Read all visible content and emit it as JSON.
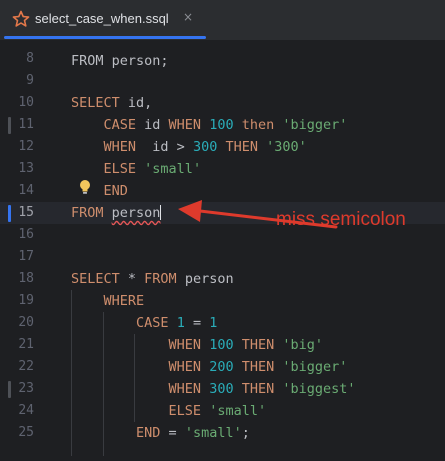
{
  "tab": {
    "filename": "select_case_when.ssql",
    "close_glyph": "×",
    "icon": "star-file-icon",
    "accent_color": "#3574f0"
  },
  "editor": {
    "partial_top_line": "FROM person;",
    "lines": [
      {
        "num": "8",
        "tokens": []
      },
      {
        "num": "9",
        "tokens": []
      },
      {
        "num": "10",
        "tokens": [
          {
            "t": "kw",
            "v": "SELECT"
          },
          {
            "t": "id",
            "v": " id,"
          }
        ]
      },
      {
        "num": "11",
        "tokens": [
          {
            "t": "id",
            "v": "    "
          },
          {
            "t": "kw",
            "v": "CASE"
          },
          {
            "t": "id",
            "v": " id "
          },
          {
            "t": "kw",
            "v": "WHEN"
          },
          {
            "t": "id",
            "v": " "
          },
          {
            "t": "num",
            "v": "100"
          },
          {
            "t": "id",
            "v": " "
          },
          {
            "t": "kw",
            "v": "then"
          },
          {
            "t": "id",
            "v": " "
          },
          {
            "t": "str",
            "v": "'bigger'"
          }
        ]
      },
      {
        "num": "12",
        "tokens": [
          {
            "t": "id",
            "v": "    "
          },
          {
            "t": "kw",
            "v": "WHEN"
          },
          {
            "t": "id",
            "v": "  id > "
          },
          {
            "t": "num",
            "v": "300"
          },
          {
            "t": "id",
            "v": " "
          },
          {
            "t": "kw",
            "v": "THEN"
          },
          {
            "t": "id",
            "v": " "
          },
          {
            "t": "str",
            "v": "'300'"
          }
        ]
      },
      {
        "num": "13",
        "tokens": [
          {
            "t": "id",
            "v": "    "
          },
          {
            "t": "kw",
            "v": "ELSE"
          },
          {
            "t": "id",
            "v": " "
          },
          {
            "t": "str",
            "v": "'small'"
          }
        ]
      },
      {
        "num": "14",
        "tokens": [
          {
            "t": "id",
            "v": "    "
          },
          {
            "t": "kw",
            "v": "END"
          }
        ]
      },
      {
        "num": "15",
        "tokens": [
          {
            "t": "kw",
            "v": "FROM"
          },
          {
            "t": "id",
            "v": " "
          },
          {
            "t": "err",
            "v": "person"
          }
        ]
      },
      {
        "num": "16",
        "tokens": []
      },
      {
        "num": "17",
        "tokens": []
      },
      {
        "num": "18",
        "tokens": [
          {
            "t": "kw",
            "v": "SELECT"
          },
          {
            "t": "id",
            "v": " * "
          },
          {
            "t": "kw",
            "v": "FROM"
          },
          {
            "t": "id",
            "v": " person"
          }
        ]
      },
      {
        "num": "19",
        "tokens": [
          {
            "t": "id",
            "v": "    "
          },
          {
            "t": "kw",
            "v": "WHERE"
          }
        ]
      },
      {
        "num": "20",
        "tokens": [
          {
            "t": "id",
            "v": "        "
          },
          {
            "t": "kw",
            "v": "CASE"
          },
          {
            "t": "id",
            "v": " "
          },
          {
            "t": "num",
            "v": "1"
          },
          {
            "t": "id",
            "v": " = "
          },
          {
            "t": "num",
            "v": "1"
          }
        ]
      },
      {
        "num": "21",
        "tokens": [
          {
            "t": "id",
            "v": "            "
          },
          {
            "t": "kw",
            "v": "WHEN"
          },
          {
            "t": "id",
            "v": " "
          },
          {
            "t": "num",
            "v": "100"
          },
          {
            "t": "id",
            "v": " "
          },
          {
            "t": "kw",
            "v": "THEN"
          },
          {
            "t": "id",
            "v": " "
          },
          {
            "t": "str",
            "v": "'big'"
          }
        ]
      },
      {
        "num": "22",
        "tokens": [
          {
            "t": "id",
            "v": "            "
          },
          {
            "t": "kw",
            "v": "WHEN"
          },
          {
            "t": "id",
            "v": " "
          },
          {
            "t": "num",
            "v": "200"
          },
          {
            "t": "id",
            "v": " "
          },
          {
            "t": "kw",
            "v": "THEN"
          },
          {
            "t": "id",
            "v": " "
          },
          {
            "t": "str",
            "v": "'bigger'"
          }
        ]
      },
      {
        "num": "23",
        "tokens": [
          {
            "t": "id",
            "v": "            "
          },
          {
            "t": "kw",
            "v": "WHEN"
          },
          {
            "t": "id",
            "v": " "
          },
          {
            "t": "num",
            "v": "300"
          },
          {
            "t": "id",
            "v": " "
          },
          {
            "t": "kw",
            "v": "THEN"
          },
          {
            "t": "id",
            "v": " "
          },
          {
            "t": "str",
            "v": "'biggest'"
          }
        ]
      },
      {
        "num": "24",
        "tokens": [
          {
            "t": "id",
            "v": "            "
          },
          {
            "t": "kw",
            "v": "ELSE"
          },
          {
            "t": "id",
            "v": " "
          },
          {
            "t": "str",
            "v": "'small'"
          }
        ]
      },
      {
        "num": "25",
        "tokens": [
          {
            "t": "id",
            "v": "        "
          },
          {
            "t": "kw",
            "v": "END"
          },
          {
            "t": "id",
            "v": " = "
          },
          {
            "t": "str",
            "v": "'small'"
          },
          {
            "t": "id",
            "v": ";"
          }
        ]
      }
    ],
    "current_line": "15",
    "changed_lines": [
      "11",
      "23"
    ],
    "colors": {
      "keyword": "#cf8e6d",
      "number": "#2aacb8",
      "string": "#6aab73",
      "identifier": "#bcbec4",
      "error_underline": "#e55757"
    },
    "intention_icon": "lightbulb-icon"
  },
  "annotation": {
    "text": "miss semicolon",
    "color": "#de3a2c",
    "arrow_icon": "red-arrow-icon"
  }
}
